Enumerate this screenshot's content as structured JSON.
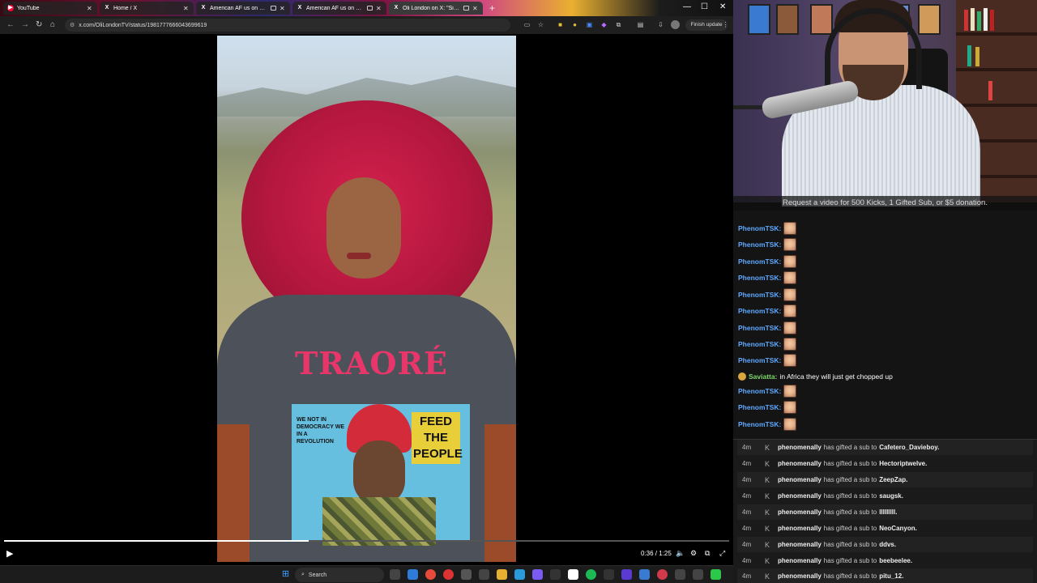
{
  "browser": {
    "tabs": [
      {
        "label": "YouTube",
        "icon": "youtube-icon",
        "color": "#ff0033"
      },
      {
        "label": "Home / X",
        "icon": "x-logo-icon",
        "color": "#ffffff"
      },
      {
        "label": "American AF us on X: \"Lib",
        "icon": "x-logo-icon",
        "color": "#ffffff"
      },
      {
        "label": "American AF us on X: \"EB",
        "icon": "x-logo-icon",
        "color": "#ffffff"
      },
      {
        "label": "Oli London on X: \"Singer K",
        "icon": "x-logo-icon",
        "color": "#ffffff"
      }
    ],
    "url": "x.com/OliLondonTV/status/1981777666043699619",
    "finish_update": "Finish update"
  },
  "video": {
    "time": "0:36 / 1:25",
    "progress_fraction": 0.42,
    "shirt_text_top": "TRAORÉ",
    "shirt_text_left": "WE NOT IN DEMOCRACY WE IN A REVOLUTION",
    "shirt_text_right": "FEED THE PEOPLE"
  },
  "webcam": {
    "banner": "Request a video for 500 Kicks, 1 Gifted Sub, or $5 donation."
  },
  "chat": {
    "messages": [
      {
        "user": "PhenomTSK:",
        "text": "",
        "emote": true
      },
      {
        "user": "PhenomTSK:",
        "text": "",
        "emote": true
      },
      {
        "user": "PhenomTSK:",
        "text": "",
        "emote": true
      },
      {
        "user": "PhenomTSK:",
        "text": "",
        "emote": true
      },
      {
        "user": "PhenomTSK:",
        "text": "",
        "emote": true
      },
      {
        "user": "PhenomTSK:",
        "text": "",
        "emote": true
      },
      {
        "user": "PhenomTSK:",
        "text": "",
        "emote": true
      },
      {
        "user": "PhenomTSK:",
        "text": "",
        "emote": true
      },
      {
        "user": "PhenomTSK:",
        "text": "",
        "emote": true
      },
      {
        "user": "Saviatta:",
        "text": "in Africa they will just get chopped up",
        "emote": false,
        "badge": true
      },
      {
        "user": "PhenomTSK:",
        "text": "",
        "emote": true
      },
      {
        "user": "PhenomTSK:",
        "text": "",
        "emote": true
      },
      {
        "user": "PhenomTSK:",
        "text": "",
        "emote": true
      }
    ]
  },
  "gifts": [
    {
      "time": "4m",
      "user": "phenomenally",
      "text": "has gifted a sub to",
      "recipient": "Cafetero_Davieboy."
    },
    {
      "time": "4m",
      "user": "phenomenally",
      "text": "has gifted a sub to",
      "recipient": "Hectoriptwelve."
    },
    {
      "time": "4m",
      "user": "phenomenally",
      "text": "has gifted a sub to",
      "recipient": "ZeepZap."
    },
    {
      "time": "4m",
      "user": "phenomenally",
      "text": "has gifted a sub to",
      "recipient": "saugsk."
    },
    {
      "time": "4m",
      "user": "phenomenally",
      "text": "has gifted a sub to",
      "recipient": "lIIIIIIIl."
    },
    {
      "time": "4m",
      "user": "phenomenally",
      "text": "has gifted a sub to",
      "recipient": "NeoCanyon."
    },
    {
      "time": "4m",
      "user": "phenomenally",
      "text": "has gifted a sub to",
      "recipient": "ddvs."
    },
    {
      "time": "4m",
      "user": "phenomenally",
      "text": "has gifted a sub to",
      "recipient": "beebeelee."
    },
    {
      "time": "4m",
      "user": "phenomenally",
      "text": "has gifted a sub to",
      "recipient": "pitu_12."
    }
  ],
  "taskbar": {
    "search_label": "Search"
  },
  "colors": {
    "chat_username": "#5ea8ff",
    "accent_hair": "#c0183c"
  }
}
